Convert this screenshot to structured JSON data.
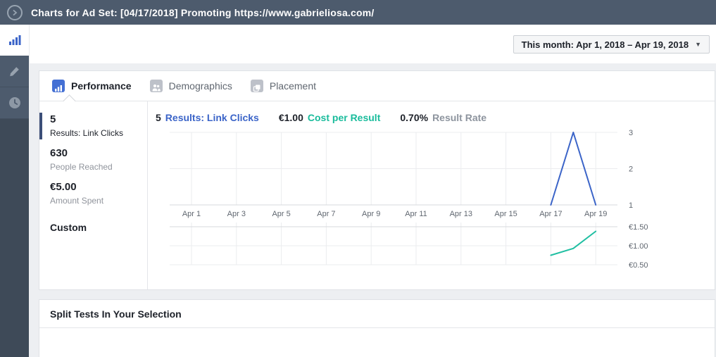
{
  "header": {
    "title": "Charts for Ad Set: [04/17/2018] Promoting https://www.gabrieliosa.com/"
  },
  "toolbar": {
    "date_range": "This month: Apr 1, 2018 – Apr 19, 2018",
    "caret": "▼"
  },
  "sidebar": {
    "items": [
      {
        "icon": "bar-chart-icon",
        "active": true
      },
      {
        "icon": "pencil-icon",
        "active": false
      },
      {
        "icon": "clock-icon",
        "active": false
      }
    ]
  },
  "tabs": [
    {
      "label": "Performance",
      "icon": "bar-chart-icon",
      "active": true
    },
    {
      "label": "Demographics",
      "icon": "people-icon",
      "active": false
    },
    {
      "label": "Placement",
      "icon": "placement-icon",
      "active": false
    }
  ],
  "stats": [
    {
      "value": "5",
      "label": "Results: Link Clicks",
      "selected": true
    },
    {
      "value": "630",
      "label": "People Reached",
      "selected": false
    },
    {
      "value": "€5.00",
      "label": "Amount Spent",
      "selected": false
    }
  ],
  "custom_label": "Custom",
  "chart_header": [
    {
      "value": "5",
      "label": "Results: Link Clicks",
      "color": "#3b64c8"
    },
    {
      "value": "€1.00",
      "label": "Cost per Result",
      "color": "#1abc9c"
    },
    {
      "value": "0.70%",
      "label": "Result Rate",
      "color": "#8d949e"
    }
  ],
  "chart_data": {
    "type": "line",
    "x_tick_labels": [
      "Apr 1",
      "Apr 3",
      "Apr 5",
      "Apr 7",
      "Apr 9",
      "Apr 11",
      "Apr 13",
      "Apr 15",
      "Apr 17",
      "Apr 19"
    ],
    "x_domain_days": [
      1,
      19
    ],
    "grid": true,
    "legend_position": "top",
    "charts": [
      {
        "name": "Results: Link Clicks",
        "color": "#3b64c8",
        "ylim": [
          1,
          3
        ],
        "yticks": [
          1,
          2,
          3
        ],
        "ytick_labels": [
          "1",
          "2",
          "3"
        ],
        "points": [
          {
            "day": 17,
            "value": 1
          },
          {
            "day": 18,
            "value": 3
          },
          {
            "day": 19,
            "value": 1
          }
        ]
      },
      {
        "name": "Cost per Result",
        "color": "#20bfa2",
        "ylim": [
          0.5,
          1.5
        ],
        "yticks": [
          0.5,
          1.0,
          1.5
        ],
        "ytick_labels": [
          "€0.50",
          "€1.00",
          "€1.50"
        ],
        "points": [
          {
            "day": 17,
            "value": 0.75
          },
          {
            "day": 18,
            "value": 0.93
          },
          {
            "day": 19,
            "value": 1.38
          }
        ]
      }
    ]
  },
  "split_tests": {
    "title": "Split Tests In Your Selection"
  },
  "colors": {
    "header_bg": "#4d5b6d",
    "sidebar_bg": "#3e4a58",
    "accent_blue": "#3b64c8",
    "teal": "#20bfa2",
    "grid_light": "#ebecef",
    "grid_dark": "#d7d9dc",
    "axis_text": "#606770"
  }
}
